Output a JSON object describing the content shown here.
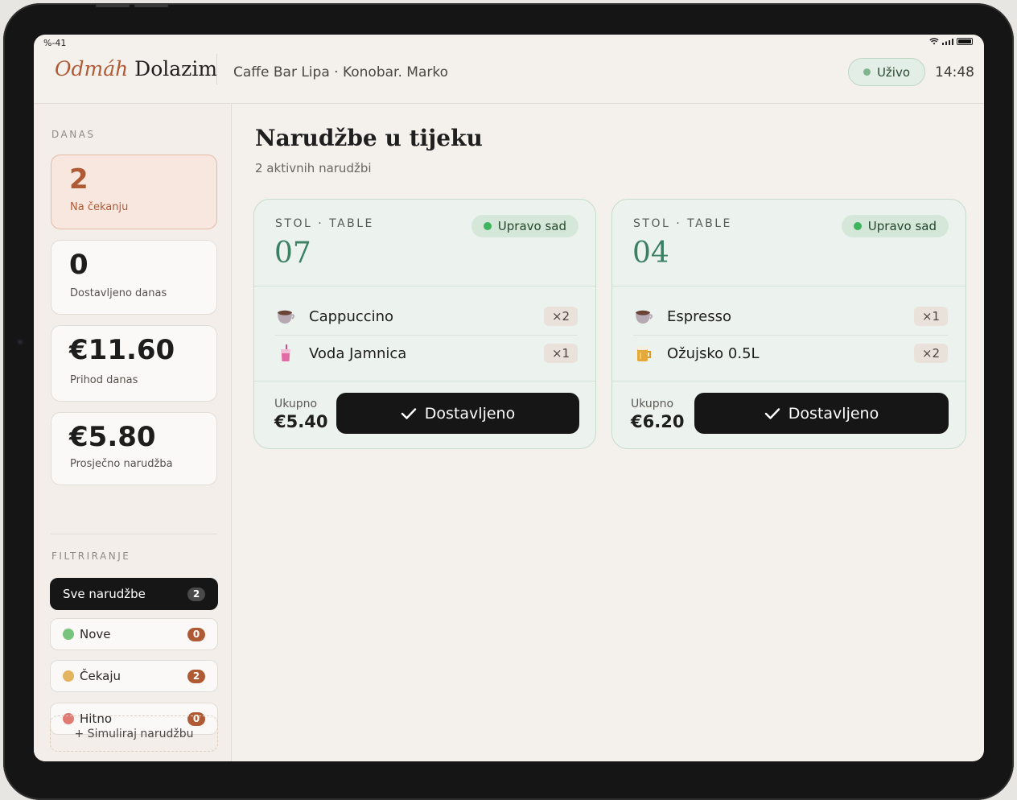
{
  "status_bar": {
    "left": "%-41"
  },
  "header": {
    "brand_accent": "Odmáh",
    "brand_rest": "Dolazim",
    "venue": "Caffe Bar Lipa · Konobar. Marko",
    "live_label": "Uživo",
    "time": "14:48"
  },
  "colors": {
    "accent": "#b05a35",
    "live": "#5aa66f",
    "dark": "#161616",
    "card_bg": "#ecf2ed"
  },
  "sidebar": {
    "today_label": "DANAS",
    "stats": [
      {
        "value": "2",
        "label": "Na čekanju"
      },
      {
        "value": "0",
        "label": "Dostavljeno danas"
      },
      {
        "value": "€11.60",
        "label": "Prihod danas"
      },
      {
        "value": "€5.80",
        "label": "Prosječno narudžba"
      }
    ],
    "filter_label": "FILTRIRANJE",
    "filters": [
      {
        "label": "Sve narudžbe",
        "count": "2",
        "dot_color": ""
      },
      {
        "label": "Nove",
        "count": "0",
        "dot_color": "#79c47c"
      },
      {
        "label": "Čekaju",
        "count": "2",
        "dot_color": "#e2b45f"
      },
      {
        "label": "Hitno",
        "count": "0",
        "dot_color": "#e07a72"
      }
    ],
    "simulate_label": "+ Simuliraj narudžbu"
  },
  "main": {
    "title": "Narudžbe u tijeku",
    "subtitle": "2 aktivnih narudžbi"
  },
  "orders": [
    {
      "table_label": "STOL · TABLE",
      "status": "Upravo sad",
      "table_number": "07",
      "items": [
        {
          "icon": "coffee-cup-icon",
          "name": "Cappuccino",
          "qty": "×2"
        },
        {
          "icon": "water-cup-icon",
          "name": "Voda Jamnica",
          "qty": "×1"
        }
      ],
      "total_label": "Ukupno",
      "total": "€5.40",
      "action_label": "Dostavljeno"
    },
    {
      "table_label": "STOL · TABLE",
      "status": "Upravo sad",
      "table_number": "04",
      "items": [
        {
          "icon": "coffee-cup-icon",
          "name": "Espresso",
          "qty": "×1"
        },
        {
          "icon": "beer-mug-icon",
          "name": "Ožujsko 0.5L",
          "qty": "×2"
        }
      ],
      "total_label": "Ukupno",
      "total": "€6.20",
      "action_label": "Dostavljeno"
    }
  ]
}
